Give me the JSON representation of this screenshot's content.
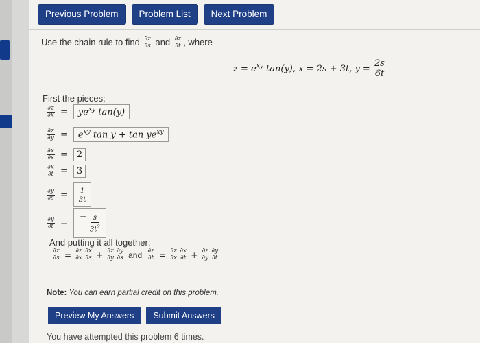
{
  "nav": {
    "previous": "Previous Problem",
    "list": "Problem List",
    "next": "Next Problem"
  },
  "prompt": {
    "text_before": "Use the chain rule to find",
    "and": "and",
    "where": ", where",
    "ds_num": "∂z",
    "ds_den": "∂s",
    "dt_num": "∂z",
    "dt_den": "∂t"
  },
  "given": {
    "z_expr": "z = e",
    "z_exp": "xy",
    "z_rest": " tan(y),  x = 2s + 3t,  y = ",
    "y_num": "2s",
    "y_den": "6t"
  },
  "pieces_label": "First the pieces:",
  "pieces": [
    {
      "num": "∂z",
      "den": "∂x",
      "answer": "ye",
      "sup": "xy",
      "tail": " tan(y)"
    },
    {
      "num": "∂z",
      "den": "∂y",
      "answer": "e",
      "sup": "xy",
      "tail": " tan y + tan ye",
      "sup2": "xy"
    },
    {
      "num": "∂x",
      "den": "∂s",
      "answer": "2"
    },
    {
      "num": "∂x",
      "den": "∂t",
      "answer": "3"
    },
    {
      "num": "∂y",
      "den": "∂s",
      "answer_num": "1",
      "answer_den": "3t"
    },
    {
      "num": "∂y",
      "den": "∂t",
      "answer_prefix": "−",
      "answer_num": "s",
      "answer_den": "3t",
      "answer_den_sup": "2"
    }
  ],
  "together_label": "And putting it all together:",
  "chain": {
    "and": "and",
    "dzds": [
      "∂z",
      "∂s"
    ],
    "dzdt": [
      "∂z",
      "∂t"
    ],
    "dzdx": [
      "∂z",
      "∂x"
    ],
    "dxds": [
      "∂x",
      "∂s"
    ],
    "dxdt": [
      "∂x",
      "∂t"
    ],
    "dzdy": [
      "∂z",
      "∂y"
    ],
    "dyds": [
      "∂y",
      "∂s"
    ],
    "dydt": [
      "∂y",
      "∂t"
    ]
  },
  "note": {
    "label": "Note:",
    "text": " You can earn partial credit on this problem."
  },
  "actions": {
    "preview": "Preview My Answers",
    "submit": "Submit Answers"
  },
  "attempted": "You have attempted this problem 6 times.",
  "colors": {
    "accent": "#1f3f86"
  }
}
